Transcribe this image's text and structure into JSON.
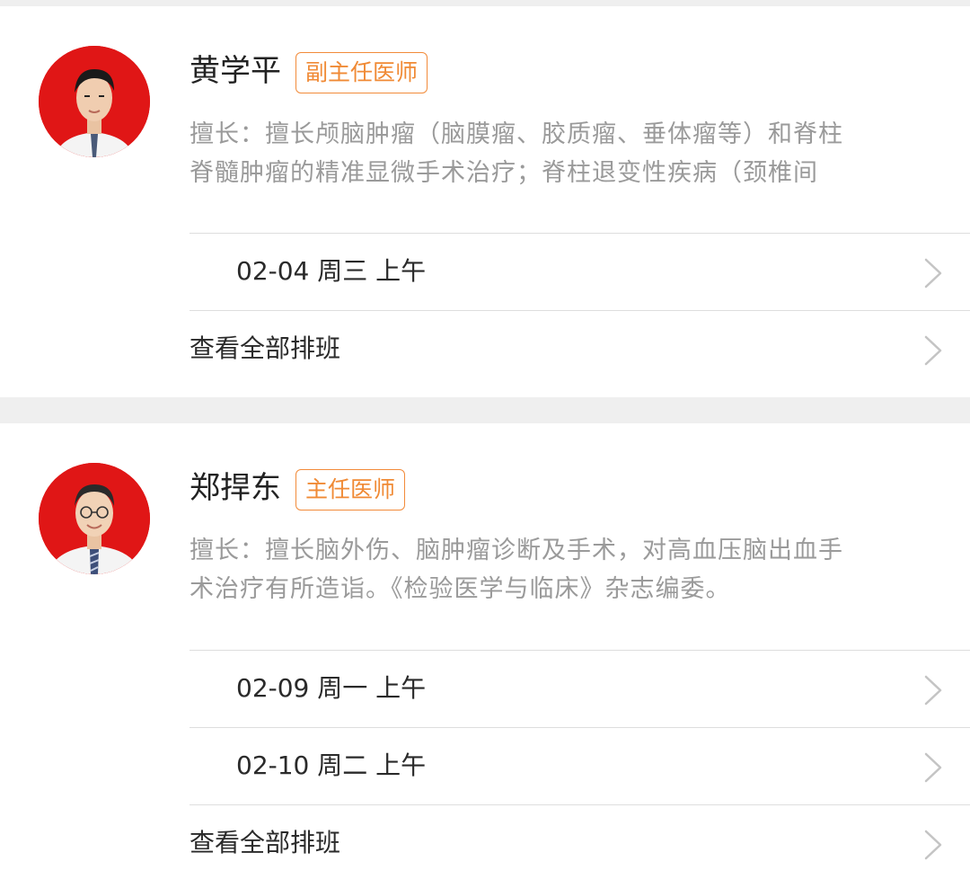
{
  "doctors": [
    {
      "name": "黄学平",
      "title": "副主任医师",
      "specialty_prefix": "擅长：",
      "specialty_line1": "擅长颅脑肿瘤（脑膜瘤、胶质瘤、垂体瘤等）和脊柱",
      "specialty_line2": "脊髓肿瘤的精准显微手术治疗；脊柱退变性疾病（颈椎间",
      "slots": [
        "02-04 周三 上午"
      ],
      "view_all_label": "查看全部排班"
    },
    {
      "name": "郑捍东",
      "title": "主任医师",
      "specialty_prefix": "擅长：",
      "specialty_line1": "擅长脑外伤、脑肿瘤诊断及手术，对高血压脑出血手",
      "specialty_line2": "术治疗有所造诣。《检验医学与临床》杂志编委。",
      "slots": [
        "02-09 周一 上午",
        "02-10 周二 上午"
      ],
      "view_all_label": "查看全部排班"
    }
  ],
  "colors": {
    "badge": "#f08a35",
    "avatar_bg": "#e01616",
    "separator": "#efefef",
    "muted_text": "#9a9a9a"
  },
  "icons": {
    "row_chevron": "chevron-right-icon"
  }
}
